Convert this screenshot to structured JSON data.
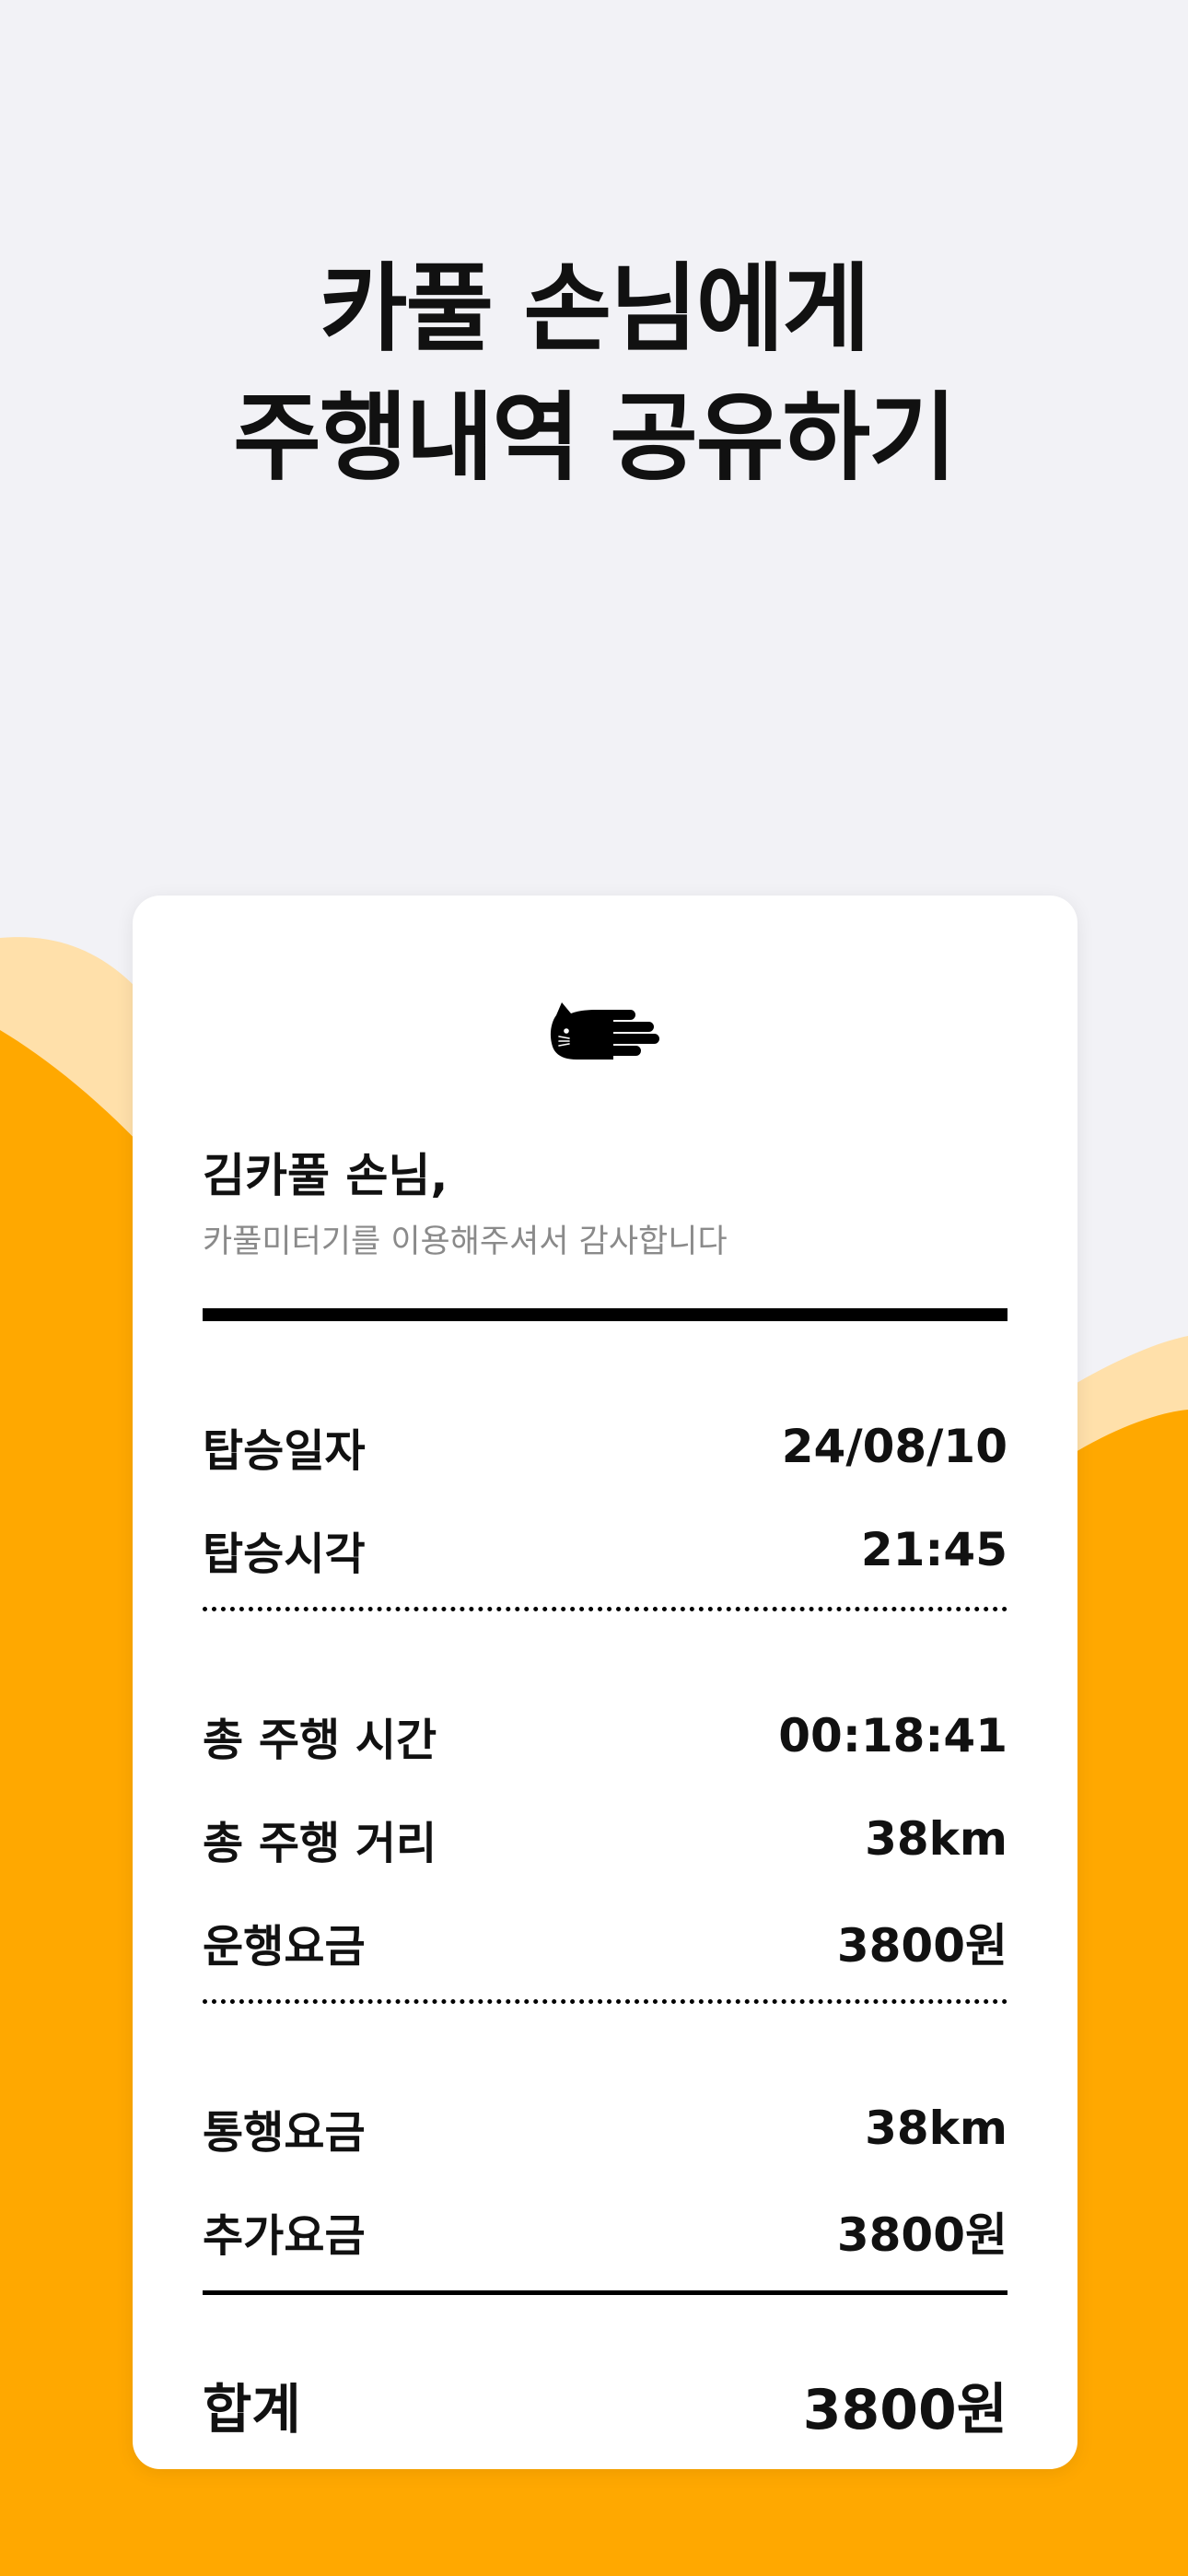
{
  "headline": {
    "line1": "카풀 손님에게",
    "line2": "주행내역 공유하기"
  },
  "colors": {
    "background": "#f2f2f6",
    "accent_orange": "#ffa800",
    "accent_light": "#ffe0aa",
    "card": "#ffffff",
    "text": "#111111",
    "muted": "#8a8a8a"
  },
  "receipt": {
    "logo_icon": "cat-hand-icon",
    "greeting": "김카풀 손님,",
    "thanks": "카풀미터기를 이용해주셔서 감사합니다",
    "ride": [
      {
        "label": "탑승일자",
        "value": "24/08/10"
      },
      {
        "label": "탑승시각",
        "value": "21:45"
      }
    ],
    "trip": [
      {
        "label": "총 주행 시간",
        "value": "00:18:41"
      },
      {
        "label": "총 주행 거리",
        "value": "38km"
      },
      {
        "label": "운행요금",
        "value": "3800원"
      }
    ],
    "extra": [
      {
        "label": "통행요금",
        "value": "38km"
      },
      {
        "label": "추가요금",
        "value": "3800원"
      }
    ],
    "total": {
      "label": "합계",
      "value": "3800원"
    }
  }
}
